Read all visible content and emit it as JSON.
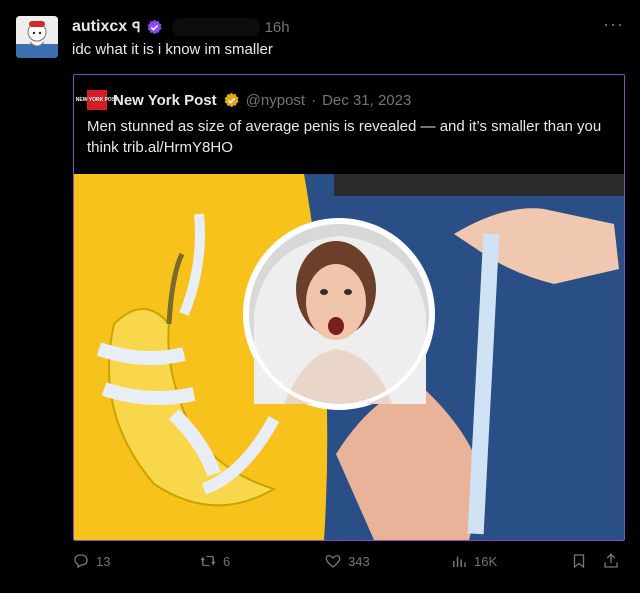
{
  "post": {
    "author_name": "autixcx",
    "author_flair": "ꟼ",
    "time": "16h",
    "text": "idc what it is i know im smaller",
    "more": "···"
  },
  "quote": {
    "logo_text": "NEW YORK POST",
    "name": "New York Post",
    "handle": "@nypost",
    "date": "Dec 31, 2023",
    "separator": "·",
    "text": "Men stunned as size of average penis is revealed — and it’s smaller than you think trib.al/HrmY8HO"
  },
  "actions": {
    "replies": "13",
    "reposts": "6",
    "likes": "343",
    "views": "16K"
  },
  "colors": {
    "accent_border": "#8b45c6",
    "verified_purple": "#8a4bf0",
    "verified_gold": "#e2a71a",
    "muted": "#71767b"
  }
}
